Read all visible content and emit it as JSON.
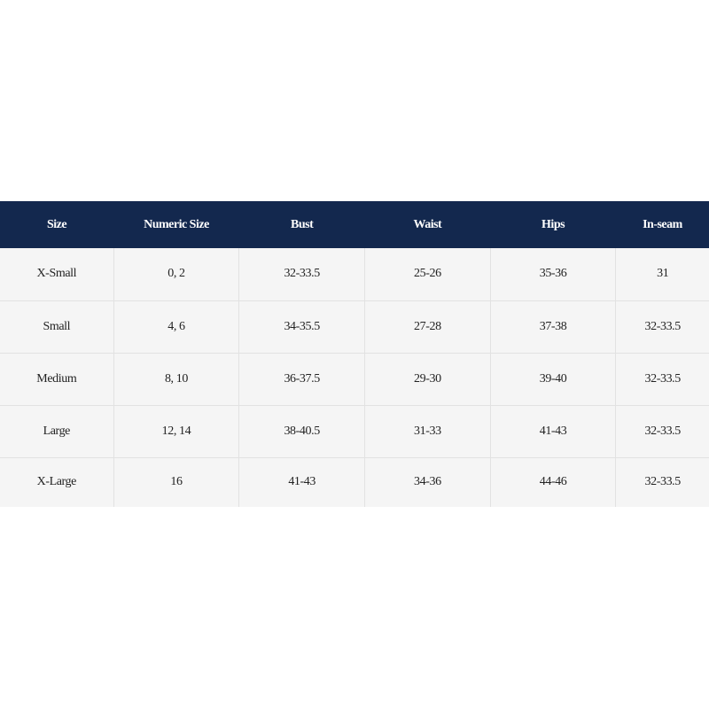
{
  "size_chart": {
    "columns": [
      "Size",
      "Numeric Size",
      "Bust",
      "Waist",
      "Hips",
      "In-seam"
    ],
    "rows": [
      [
        "X-Small",
        "0, 2",
        "32-33.5",
        "25-26",
        "35-36",
        "31"
      ],
      [
        "Small",
        "4, 6",
        "34-35.5",
        "27-28",
        "37-38",
        "32-33.5"
      ],
      [
        "Medium",
        "8, 10",
        "36-37.5",
        "29-30",
        "39-40",
        "32-33.5"
      ],
      [
        "Large",
        "12, 14",
        "38-40.5",
        "31-33",
        "41-43",
        "32-33.5"
      ],
      [
        "X-Large",
        "16",
        "41-43",
        "34-36",
        "44-46",
        "32-33.5"
      ]
    ],
    "header_color": "#13284e",
    "row_color": "#f5f5f5"
  }
}
